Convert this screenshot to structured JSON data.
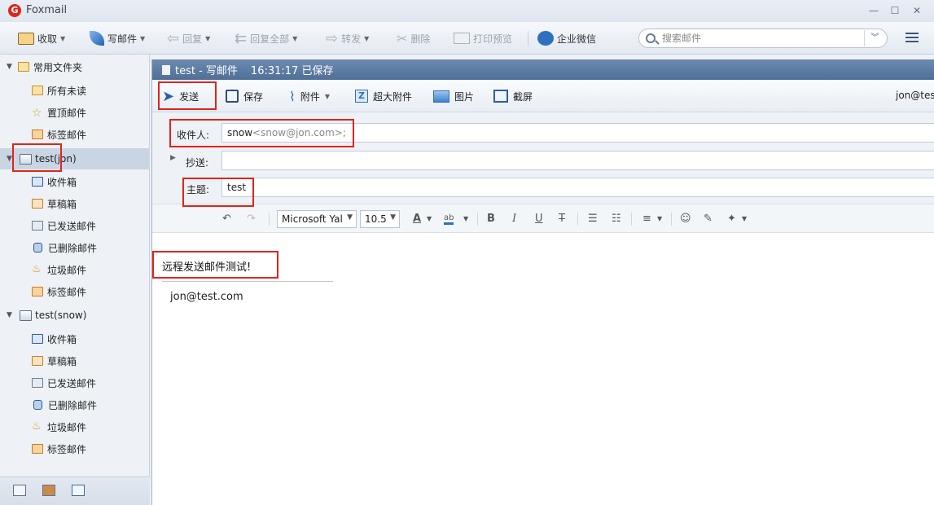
{
  "app": {
    "title": "Foxmail",
    "logo": "G"
  },
  "window_controls": {
    "minimize": "—",
    "maximize": "☐",
    "close": "✕"
  },
  "toolbar": {
    "receive": "收取",
    "compose": "写邮件",
    "reply": "回复",
    "reply_all": "回复全部",
    "forward": "转发",
    "delete": "删除",
    "print_preview": "打印预览",
    "enterprise_wechat": "企业微信",
    "search_placeholder": "搜索邮件"
  },
  "sidebar": {
    "common_folder": "常用文件夹",
    "common_items": [
      "所有未读",
      "置顶邮件",
      "标签邮件"
    ],
    "accounts": [
      {
        "name": "test(jon)",
        "folders": [
          "收件箱",
          "草稿箱",
          "已发送邮件",
          "已删除邮件",
          "垃圾邮件",
          "标签邮件"
        ]
      },
      {
        "name": "test(snow)",
        "folders": [
          "收件箱",
          "草稿箱",
          "已发送邮件",
          "已删除邮件",
          "垃圾邮件",
          "标签邮件"
        ]
      }
    ]
  },
  "compose": {
    "title": "test - 写邮件",
    "saved_status": "16:31:17 已保存",
    "toolbar": {
      "send": "发送",
      "save": "保存",
      "attach": "附件",
      "large_attach": "超大附件",
      "image": "图片",
      "screenshot": "截屏"
    },
    "user": "jon@tes",
    "to_label": "收件人:",
    "to_name": "snow",
    "to_email": "<snow@jon.com>;",
    "cc_label": "抄送:",
    "subject_label": "主题:",
    "subject_value": "test",
    "font_name": "Microsoft Yal",
    "font_size": "10.5",
    "body_text": "远程发送邮件测试!",
    "signature": "jon@test.com"
  },
  "colors": {
    "highlight_box": "#e2231a",
    "compose_title_bar": "#5877a0",
    "selected_row": "#c9d5e3"
  }
}
